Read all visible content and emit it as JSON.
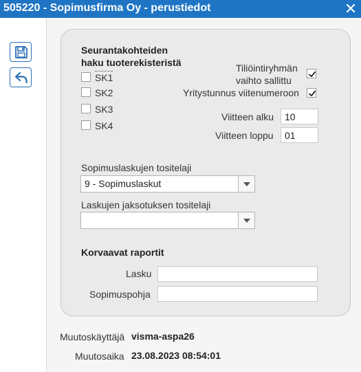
{
  "window": {
    "title": "505220 - Sopimusfirma Oy - perustiedot",
    "close_icon": "close-icon"
  },
  "toolbar": {
    "save_icon": "save-icon",
    "undo_icon": "undo-icon"
  },
  "form": {
    "tracking_heading_line1": "Seurantakohteiden",
    "tracking_heading_line2": "haku tuoterekisteristä",
    "tracking_items": [
      {
        "label": "SK1",
        "checked": false
      },
      {
        "label": "SK2",
        "checked": false
      },
      {
        "label": "SK3",
        "checked": false
      },
      {
        "label": "SK4",
        "checked": false
      }
    ],
    "account_group_change_line1": "Tiliöintiryhmän",
    "account_group_change_line2": "vaihto sallittu",
    "account_group_change_checked": true,
    "business_id_reference_label": "Yritystunnus viitenumeroon",
    "business_id_reference_checked": true,
    "reference_start_label": "Viitteen alku",
    "reference_start_value": "10",
    "reference_end_label": "Viitteen loppu",
    "reference_end_value": "01",
    "contract_invoice_voucher_label": "Sopimuslaskujen tositelaji",
    "contract_invoice_voucher_value": "9 - Sopimuslaskut",
    "invoice_accrual_voucher_label": "Laskujen jaksotuksen tositelaji",
    "invoice_accrual_voucher_value": "",
    "replacement_reports_heading": "Korvaavat raportit",
    "invoice_report_label": "Lasku",
    "invoice_report_value": "",
    "contract_template_label": "Sopimuspohja",
    "contract_template_value": ""
  },
  "footer": {
    "modified_by_label": "Muutoskäyttäjä",
    "modified_by_value": "visma-aspa26",
    "modified_time_label": "Muutosaika",
    "modified_time_value": "23.08.2023 08:54:01"
  },
  "colors": {
    "titlebar": "#1f75c4",
    "accent": "#2a6fb5",
    "card_background": "#eaeaea",
    "content_background": "#f5f5f5"
  }
}
